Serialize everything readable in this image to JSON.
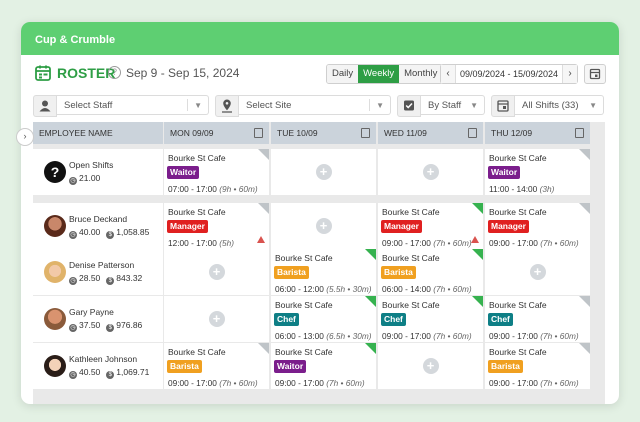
{
  "app": {
    "title": "Cup & Crumble"
  },
  "header": {
    "title": "ROSTER",
    "help": "?",
    "date_range": "Sep 9 - Sep 15, 2024"
  },
  "view_toggle": {
    "options": [
      "Daily",
      "Weekly",
      "Monthly"
    ],
    "active": "Weekly"
  },
  "date_picker": {
    "prev": "‹",
    "value": "09/09/2024 - 15/09/2024",
    "next": "›"
  },
  "filters": {
    "staff_placeholder": "Select Staff",
    "site_placeholder": "Select Site",
    "group_by": "By Staff",
    "shifts": "All Shifts (33)"
  },
  "columns": {
    "employee": "EMPLOYEE NAME",
    "days": [
      "MON 09/09",
      "TUE 10/09",
      "WED 11/09",
      "THU 12/09"
    ]
  },
  "toggle_glyph": "›",
  "add_glyph": "+",
  "colors": {
    "accent": "#2e9e45",
    "topbar": "#5ecf72",
    "waitor": "#7b1e8c",
    "manager": "#e02020",
    "barista": "#f0a020",
    "chef": "#0e7f86"
  },
  "rows": [
    {
      "name": "Open Shifts",
      "hours": "21.00",
      "cost": "",
      "shifts": [
        {
          "site": "Bourke St Cafe",
          "role": "Waitor",
          "color": "#7b1e8c",
          "time": "07:00 - 17:00",
          "detail": "(9h • 60m)",
          "status": "grey",
          "warn": false
        },
        null,
        null,
        {
          "site": "Bourke St Cafe",
          "role": "Waitor",
          "color": "#7b1e8c",
          "time": "11:00 - 14:00",
          "detail": "(3h)",
          "status": "grey",
          "warn": false
        }
      ]
    },
    {
      "name": "Bruce Deckand",
      "hours": "40.00",
      "cost": "1,058.85",
      "shifts": [
        {
          "site": "Bourke St Cafe",
          "role": "Manager",
          "color": "#e02020",
          "time": "12:00 - 17:00",
          "detail": "(5h)",
          "status": "grey",
          "warn": true
        },
        null,
        {
          "site": "Bourke St Cafe",
          "role": "Manager",
          "color": "#e02020",
          "time": "09:00 - 17:00",
          "detail": "(7h • 60m)",
          "status": "green",
          "warn": true
        },
        {
          "site": "Bourke St Cafe",
          "role": "Manager",
          "color": "#e02020",
          "time": "09:00 - 17:00",
          "detail": "(7h • 60m)",
          "status": "grey",
          "warn": false
        }
      ]
    },
    {
      "name": "Denise Patterson",
      "hours": "28.50",
      "cost": "843.32",
      "shifts": [
        null,
        {
          "site": "Bourke St Cafe",
          "role": "Barista",
          "color": "#f0a020",
          "time": "06:00 - 12:00",
          "detail": "(5.5h • 30m)",
          "status": "green",
          "warn": false
        },
        {
          "site": "Bourke St Cafe",
          "role": "Barista",
          "color": "#f0a020",
          "time": "06:00 - 14:00",
          "detail": "(7h • 60m)",
          "status": "green",
          "warn": false
        },
        null
      ]
    },
    {
      "name": "Gary Payne",
      "hours": "37.50",
      "cost": "976.86",
      "shifts": [
        null,
        {
          "site": "Bourke St Cafe",
          "role": "Chef",
          "color": "#0e7f86",
          "time": "06:00 - 13:00",
          "detail": "(6.5h • 30m)",
          "status": "green",
          "warn": false
        },
        {
          "site": "Bourke St Cafe",
          "role": "Chef",
          "color": "#0e7f86",
          "time": "09:00 - 17:00",
          "detail": "(7h • 60m)",
          "status": "green",
          "warn": false
        },
        {
          "site": "Bourke St Cafe",
          "role": "Chef",
          "color": "#0e7f86",
          "time": "09:00 - 17:00",
          "detail": "(7h • 60m)",
          "status": "grey",
          "warn": false
        }
      ]
    },
    {
      "name": "Kathleen Johnson",
      "hours": "40.50",
      "cost": "1,069.71",
      "shifts": [
        {
          "site": "Bourke St Cafe",
          "role": "Barista",
          "color": "#f0a020",
          "time": "09:00 - 17:00",
          "detail": "(7h • 60m)",
          "status": "grey",
          "warn": false
        },
        {
          "site": "Bourke St Cafe",
          "role": "Waitor",
          "color": "#7b1e8c",
          "time": "09:00 - 17:00",
          "detail": "(7h • 60m)",
          "status": "green",
          "warn": false
        },
        null,
        {
          "site": "Bourke St Cafe",
          "role": "Barista",
          "color": "#f0a020",
          "time": "09:00 - 17:00",
          "detail": "(7h • 60m)",
          "status": "grey",
          "warn": false
        }
      ]
    }
  ]
}
